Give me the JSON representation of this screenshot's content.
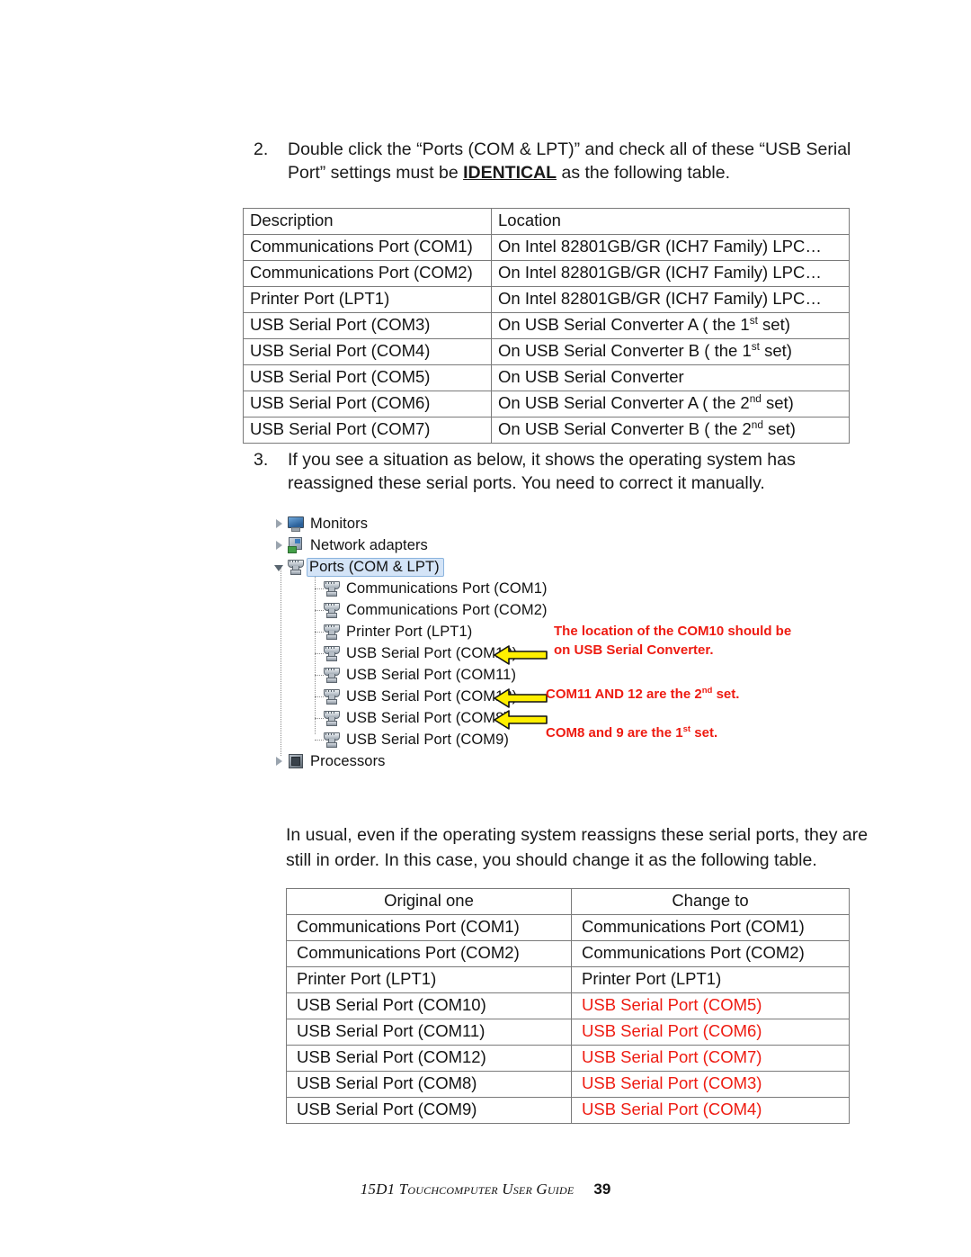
{
  "steps": [
    {
      "number": "2.",
      "text_before": "Double click the “Ports (COM & LPT)” and check all of these “USB Serial Port” settings must be ",
      "emphasis": "IDENTICAL",
      "text_after": " as the following table."
    },
    {
      "number": "3.",
      "text": "If you see a situation as below, it shows the operating system has reassigned these serial ports. You need to correct it manually."
    }
  ],
  "ports_table": {
    "headers": [
      "Description",
      "Location"
    ],
    "rows": [
      {
        "description": "Communications Port (COM1)",
        "location": "On Intel 82801GB/GR (ICH7 Family) LPC…",
        "sup": ""
      },
      {
        "description": "Communications Port (COM2)",
        "location": "On Intel 82801GB/GR (ICH7 Family) LPC…",
        "sup": ""
      },
      {
        "description": "Printer Port (LPT1)",
        "location": "On Intel 82801GB/GR (ICH7 Family) LPC…",
        "sup": ""
      },
      {
        "description": "USB Serial Port (COM3)",
        "location_pre": "On USB Serial Converter A ( the 1",
        "sup": "st",
        "location_post": " set)"
      },
      {
        "description": "USB Serial Port (COM4)",
        "location_pre": "On USB Serial Converter B ( the 1",
        "sup": "st",
        "location_post": " set)"
      },
      {
        "description": "USB Serial Port (COM5)",
        "location": "On USB Serial Converter",
        "sup": ""
      },
      {
        "description": "USB Serial Port (COM6)",
        "location_pre": "On USB Serial Converter A ( the 2",
        "sup": "nd",
        "location_post": " set)"
      },
      {
        "description": "USB Serial Port (COM7)",
        "location_pre": "On USB Serial Converter B ( the 2",
        "sup": "nd",
        "location_post": " set)"
      }
    ]
  },
  "device_manager": {
    "tree": [
      {
        "label": "Monitors",
        "icon": "monitor-icon",
        "expander": "collapsed",
        "depth": 0,
        "selected": false
      },
      {
        "label": "Network adapters",
        "icon": "network-adapter-icon",
        "expander": "collapsed",
        "depth": 0,
        "selected": false
      },
      {
        "label": "Ports (COM & LPT)",
        "icon": "port-icon",
        "expander": "expanded",
        "depth": 0,
        "selected": true
      },
      {
        "label": "Communications Port (COM1)",
        "icon": "port-icon",
        "expander": "none",
        "depth": 1,
        "selected": false
      },
      {
        "label": "Communications Port (COM2)",
        "icon": "port-icon",
        "expander": "none",
        "depth": 1,
        "selected": false
      },
      {
        "label": "Printer Port (LPT1)",
        "icon": "port-icon",
        "expander": "none",
        "depth": 1,
        "selected": false
      },
      {
        "label": "USB Serial Port (COM10)",
        "icon": "port-icon",
        "expander": "none",
        "depth": 1,
        "selected": false
      },
      {
        "label": "USB Serial Port (COM11)",
        "icon": "port-icon",
        "expander": "none",
        "depth": 1,
        "selected": false
      },
      {
        "label": "USB Serial Port (COM12)",
        "icon": "port-icon",
        "expander": "none",
        "depth": 1,
        "selected": false
      },
      {
        "label": "USB Serial Port (COM8)",
        "icon": "port-icon",
        "expander": "none",
        "depth": 1,
        "selected": false
      },
      {
        "label": "USB Serial Port (COM9)",
        "icon": "port-icon",
        "expander": "none",
        "depth": 1,
        "selected": false
      },
      {
        "label": "Processors",
        "icon": "processor-icon",
        "expander": "collapsed",
        "depth": 0,
        "selected": false
      }
    ],
    "arrow_color": "#ffef00",
    "annotation_color": "#ee1b11",
    "annotations": [
      {
        "line1": "The location of the COM10 should be",
        "line2": "on USB Serial Converter."
      },
      {
        "pre": "COM11 AND 12 are the 2",
        "sup": "nd",
        "post": " set."
      },
      {
        "pre": "COM8 and 9 are the 1",
        "sup": "st",
        "post": " set."
      }
    ]
  },
  "usual_paragraph": "In usual, even if the operating system reassigns these serial ports, they are still in order. In this case, you should change it as the following table.",
  "remap_table": {
    "headers": [
      "Original one",
      "Change to"
    ],
    "rows": [
      {
        "original": "Communications Port (COM1)",
        "change_to": "Communications Port (COM1)",
        "changed": false
      },
      {
        "original": "Communications Port (COM2)",
        "change_to": "Communications Port (COM2)",
        "changed": false
      },
      {
        "original": "Printer Port (LPT1)",
        "change_to": "Printer Port (LPT1)",
        "changed": false
      },
      {
        "original": "USB Serial Port (COM10)",
        "change_to": "USB Serial Port (COM5)",
        "changed": true
      },
      {
        "original": "USB Serial Port (COM11)",
        "change_to": "USB Serial Port (COM6)",
        "changed": true
      },
      {
        "original": "USB Serial Port (COM12)",
        "change_to": "USB Serial Port (COM7)",
        "changed": true
      },
      {
        "original": "USB Serial Port (COM8)",
        "change_to": "USB Serial Port (COM3)",
        "changed": true
      },
      {
        "original": "USB Serial Port (COM9)",
        "change_to": "USB Serial Port (COM4)",
        "changed": true
      }
    ]
  },
  "footer": {
    "title": "15D1 Touchcomputer User Guide",
    "page": "39"
  }
}
